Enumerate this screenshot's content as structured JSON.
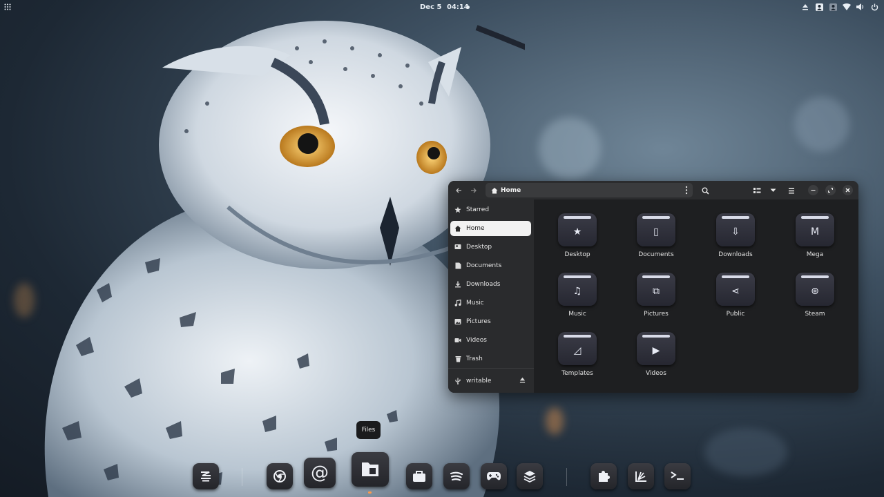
{
  "topbar": {
    "date": "Dec 5",
    "time": "04:14",
    "tray_icons": [
      "eject-icon",
      "contacts-icon",
      "person-icon",
      "wifi-icon",
      "volume-icon",
      "power-icon"
    ]
  },
  "window": {
    "path": "Home",
    "sidebar": [
      {
        "label": "Starred",
        "icon": "star-icon",
        "active": false
      },
      {
        "label": "Home",
        "icon": "home-icon",
        "active": true
      },
      {
        "label": "Desktop",
        "icon": "desktop-icon",
        "active": false
      },
      {
        "label": "Documents",
        "icon": "document-icon",
        "active": false
      },
      {
        "label": "Downloads",
        "icon": "download-icon",
        "active": false
      },
      {
        "label": "Music",
        "icon": "music-icon",
        "active": false
      },
      {
        "label": "Pictures",
        "icon": "picture-icon",
        "active": false
      },
      {
        "label": "Videos",
        "icon": "video-icon",
        "active": false
      },
      {
        "label": "Trash",
        "icon": "trash-icon",
        "active": false
      }
    ],
    "device": {
      "label": "writable",
      "icon": "usb-icon"
    },
    "folders": [
      {
        "label": "Desktop",
        "glyph": "★"
      },
      {
        "label": "Documents",
        "glyph": "▯"
      },
      {
        "label": "Downloads",
        "glyph": "⇩"
      },
      {
        "label": "Mega",
        "glyph": "M"
      },
      {
        "label": "Music",
        "glyph": "♫"
      },
      {
        "label": "Pictures",
        "glyph": "⧉"
      },
      {
        "label": "Public",
        "glyph": "⋖"
      },
      {
        "label": "Steam",
        "glyph": "⊛"
      },
      {
        "label": "Templates",
        "glyph": "◿"
      },
      {
        "label": "Videos",
        "glyph": "▶"
      }
    ]
  },
  "tooltip": "Files",
  "dock": [
    "zorin-icon",
    "chrome-icon",
    "email-icon",
    "files-icon",
    "store-icon",
    "spotify-icon",
    "games-icon",
    "layers-icon",
    "extensions-icon",
    "system-monitor-icon",
    "terminal-icon"
  ],
  "colors": {
    "accent": "#f2f2f2",
    "running_indicator": "#ff9a4a"
  }
}
